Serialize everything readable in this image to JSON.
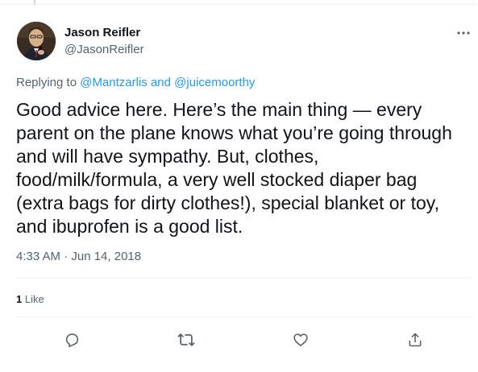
{
  "tweet": {
    "author": {
      "name": "Jason Reifler",
      "handle": "@JasonReifler"
    },
    "replying": {
      "prefix": "Replying to ",
      "user1": "@Mantzarlis",
      "and": " and ",
      "user2": "@juicemoorthy"
    },
    "text": "Good advice here. Here’s the main thing — every parent on the plane knows what you’re going through and will have sympathy. But, clothes, food/milk/formula, a very well stocked diaper bag (extra bags for dirty clothes!), special blanket or toy, and ibuprofen is a good list.",
    "timestamp": "4:33 AM · Jun 14, 2018",
    "likes": {
      "count": "1",
      "label": "Like"
    }
  },
  "icons": {
    "more": "more-dots-icon",
    "reply": "reply-bubble-icon",
    "retweet": "retweet-arrows-icon",
    "like": "heart-icon",
    "share": "share-upload-icon"
  },
  "colors": {
    "text": "#0f1419",
    "secondary": "#536471",
    "link": "#1d9bf0",
    "border": "#eff3f4"
  }
}
